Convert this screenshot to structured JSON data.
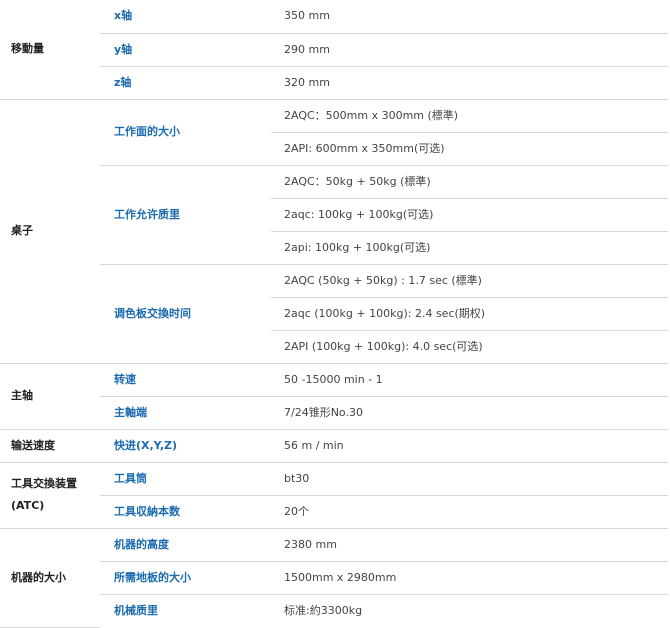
{
  "rows": {
    "travel": {
      "label": "移動量",
      "x": "x轴",
      "x_val": "350 mm",
      "y": "y轴",
      "y_val": "290 mm",
      "z": "z轴",
      "z_val": "320 mm"
    },
    "table": {
      "label": "桌子",
      "size_label": "工作面的大小",
      "size_v1": "2AQC：500mm x 300mm (標準)",
      "size_v2": "2API: 600mm x 350mm(可选)",
      "load_label": "工作允许质里",
      "load_v1": "2AQC：50kg + 50kg (標準)",
      "load_v2": "2aqc: 100kg + 100kg(可选)",
      "load_v3": "2api: 100kg + 100kg(可选)",
      "pallet_label": "调色板交換时间",
      "pallet_v1": "2AQC (50kg + 50kg) : 1.7 sec (標準)",
      "pallet_v2": "2aqc (100kg + 100kg): 2.4 sec(期权)",
      "pallet_v3": "2API (100kg + 100kg): 4.0 sec(可选)"
    },
    "spindle": {
      "label": "主轴",
      "speed_label": "转速",
      "speed_val": "50 -15000 min - 1",
      "end_label": "主軸端",
      "end_val": "7/24锥形No.30"
    },
    "feed": {
      "label": "输送速度",
      "rapid_label": "快进(X,Y,Z)",
      "rapid_val": "56 m / min"
    },
    "atc": {
      "label_line1": "工具交換装置",
      "label_line2": "(ATC)",
      "shank_label": "工具筒",
      "shank_val": "bt30",
      "capacity_label": "工具収納本数",
      "capacity_val": "20个"
    },
    "machine": {
      "label": "机器的大小",
      "height_label": "机器的高度",
      "height_val": "2380 mm",
      "floor_label": "所需地板的大小",
      "floor_val": "1500mm x 2980mm",
      "weight_label": "机械质里",
      "weight_val": "标准:約3300kg"
    }
  }
}
